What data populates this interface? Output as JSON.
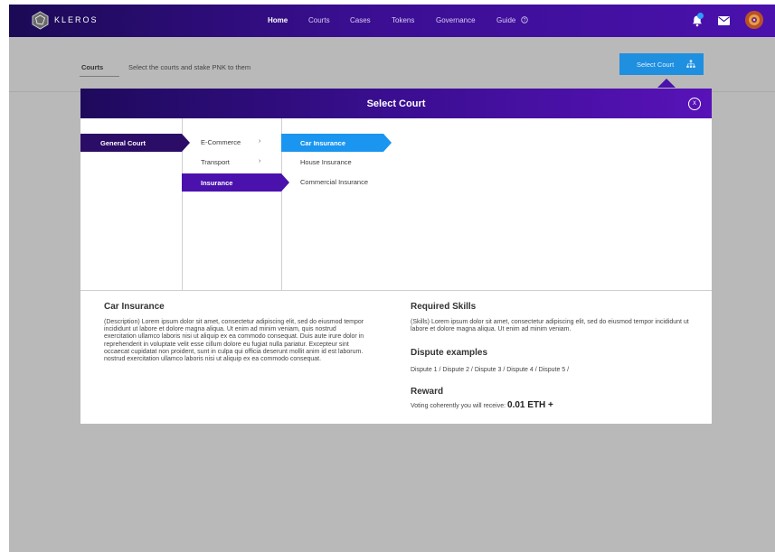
{
  "app": {
    "brand": "KLEROS"
  },
  "nav": {
    "items": [
      {
        "label": "Home",
        "active": true
      },
      {
        "label": "Courts",
        "active": false
      },
      {
        "label": "Cases",
        "active": false
      },
      {
        "label": "Tokens",
        "active": false
      },
      {
        "label": "Governance",
        "active": false
      },
      {
        "label": "Guide",
        "active": false
      }
    ],
    "guide_icon": "help-circle-icon",
    "notification_count": "1"
  },
  "subheader": {
    "tab": "Courts",
    "description": "Select the courts and stake PNK to them",
    "button_label": "Select Court"
  },
  "modal": {
    "title": "Select Court",
    "close_label": "X",
    "column1": [
      {
        "label": "General Court",
        "selected": true
      }
    ],
    "column2": [
      {
        "label": "E-Commerce",
        "has_children": true
      },
      {
        "label": "Transport",
        "has_children": true
      },
      {
        "label": "Insurance",
        "selected": true
      }
    ],
    "column3": [
      {
        "label": "Car Insurance",
        "selected": true
      },
      {
        "label": "House Insurance"
      },
      {
        "label": "Commercial Insurance"
      }
    ],
    "details": {
      "title": "Car Insurance",
      "description": "(Description) Lorem ipsum dolor sit amet, consectetur adipiscing elit, sed do eiusmod tempor incididunt ut labore et dolore magna aliqua. Ut enim ad minim veniam, quis nostrud exercitation ullamco laboris nisi ut aliquip ex ea commodo consequat. Duis aute irure dolor in reprehenderit in voluptate velit esse cillum dolore eu fugiat nulla pariatur. Excepteur sint occaecat cupidatat non proident, sunt in culpa qui officia deserunt mollit anim id est laborum. nostrud exercitation ullamco laboris nisi ut aliquip ex ea commodo consequat.",
      "skills_title": "Required Skills",
      "skills_text": "(Skills) Lorem ipsum dolor sit amet, consectetur adipiscing elit, sed do eiusmod tempor incididunt ut labore et dolore magna aliqua. Ut enim ad minim veniam.",
      "disputes_title": "Dispute examples",
      "disputes_text": "Dispute 1 / Dispute 2 / Dispute 3 / Dispute 4 / Dispute 5 /",
      "reward_title": "Reward",
      "reward_prefix": "Voting coherently you will receive:",
      "reward_value": "0.01 ETH +"
    }
  },
  "colors": {
    "nav_bg": "#3a0e91",
    "accent_purple": "#4a11ad",
    "accent_blue": "#1f8fe0",
    "overlay": "#b9b9b9"
  }
}
